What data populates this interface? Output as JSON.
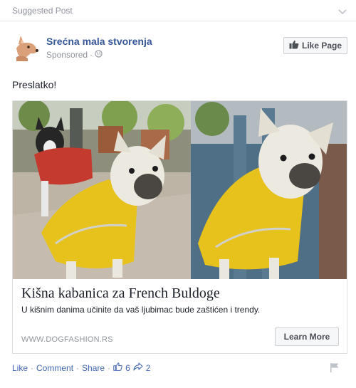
{
  "header": {
    "label": "Suggested Post"
  },
  "page": {
    "name": "Srećna mala stvorenja",
    "sponsored": "Sponsored"
  },
  "like_page_label": "Like Page",
  "post": {
    "text": "Preslatko!"
  },
  "card": {
    "title": "Kišna kabanica za French Buldoge",
    "description": "U kišnim danima učinite da vaš ljubimac bude zaštićen i trendy.",
    "domain": "WWW.DOGFASHION.RS",
    "cta_label": "Learn More"
  },
  "actions": {
    "like": "Like",
    "comment": "Comment",
    "share": "Share",
    "sep": "·",
    "likes_count": "6",
    "shares_count": "2"
  },
  "icons": [
    "chevron-down-icon",
    "globe-icon",
    "thumbs-up-icon",
    "share-arrow-icon",
    "flag-icon",
    "dog-avatar-icon"
  ],
  "colors": {
    "link": "#365899",
    "action": "#4267b2",
    "muted": "#90949c",
    "coat": "#e8c21c"
  }
}
